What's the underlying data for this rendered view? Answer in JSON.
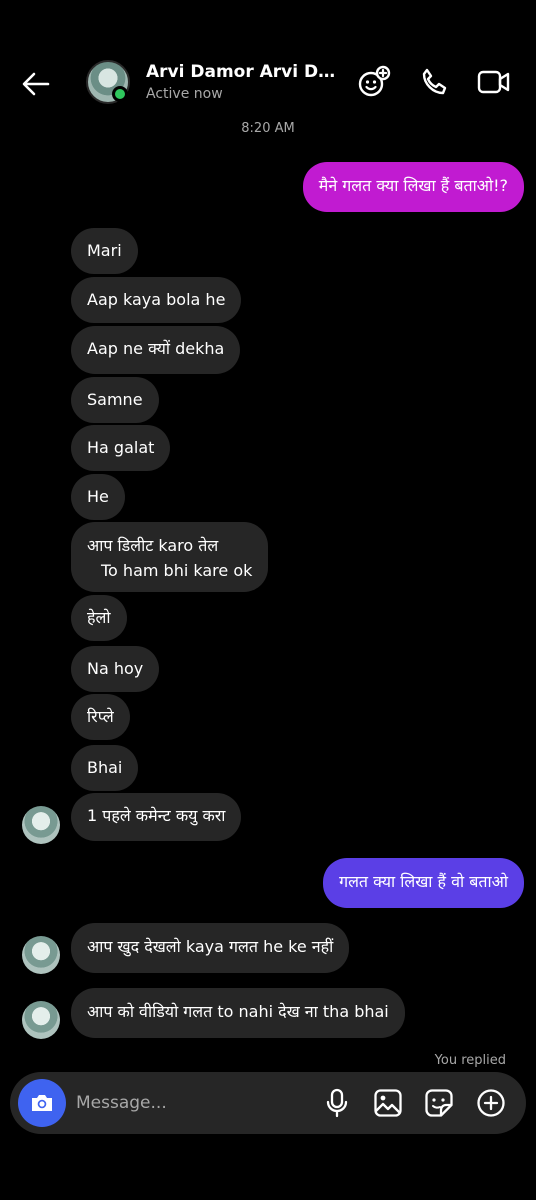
{
  "header": {
    "name": "Arvi Damor Arvi Da...",
    "status": "Active now"
  },
  "timestamp": "8:20 AM",
  "messages": {
    "m1": "मैने गलत क्या लिखा हैं बताओ!?",
    "m2": "Mari",
    "m3": "Aap kaya bola he",
    "m4": "Aap ne क्यों dekha",
    "m5": "Samne",
    "m6": "Ha galat",
    "m7": "He",
    "m8a": "आप डिलीट karo तेल",
    "m8b": "To ham bhi kare ok",
    "m9": "हेलो",
    "m10": "Na hoy",
    "m11": "रिप्ले",
    "m12": "Bhai",
    "m13": "1 पहले कमेन्ट कयु करा",
    "m14": "गलत क्या लिखा हैं वो बताओ",
    "m15": "आप खुद देखलो kaya गलत he ke नहीं",
    "m16": "आप को वीडियो गलत to nahi देख ना tha bhai"
  },
  "replied_label": "You replied",
  "composer": {
    "placeholder": "Message..."
  },
  "colors": {
    "outgoing_pink": "#c11bd1",
    "outgoing_blue": "#5b3fe6",
    "incoming": "#262626",
    "camera": "#3f63f0",
    "online": "#2fc75d"
  },
  "icons": [
    "back-arrow-icon",
    "effects-icon",
    "phone-icon",
    "video-icon",
    "camera-icon",
    "mic-icon",
    "gallery-icon",
    "sticker-icon",
    "plus-icon"
  ]
}
